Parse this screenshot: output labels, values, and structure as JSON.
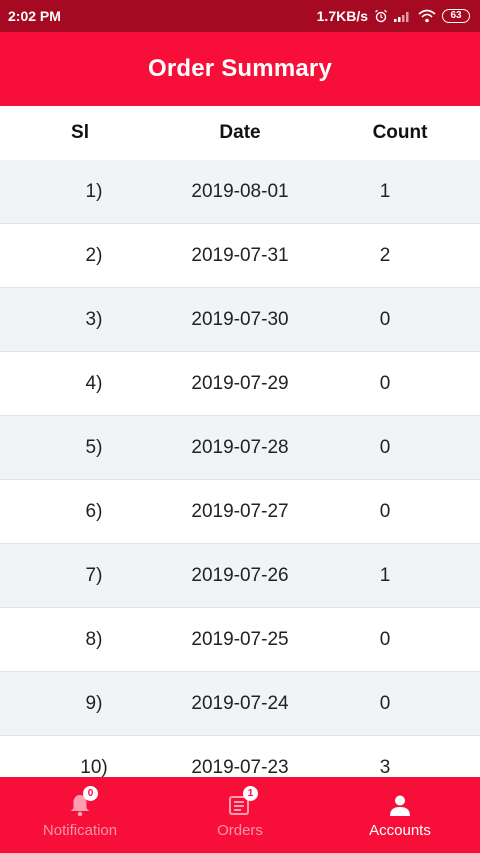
{
  "status_bar": {
    "time": "2:02 PM",
    "speed": "1.7KB/s",
    "battery": "63"
  },
  "header": {
    "title": "Order Summary"
  },
  "table": {
    "columns": [
      "Sl",
      "Date",
      "Count"
    ],
    "rows": [
      {
        "sl": "1)",
        "date": "2019-08-01",
        "count": "1"
      },
      {
        "sl": "2)",
        "date": "2019-07-31",
        "count": "2"
      },
      {
        "sl": "3)",
        "date": "2019-07-30",
        "count": "0"
      },
      {
        "sl": "4)",
        "date": "2019-07-29",
        "count": "0"
      },
      {
        "sl": "5)",
        "date": "2019-07-28",
        "count": "0"
      },
      {
        "sl": "6)",
        "date": "2019-07-27",
        "count": "0"
      },
      {
        "sl": "7)",
        "date": "2019-07-26",
        "count": "1"
      },
      {
        "sl": "8)",
        "date": "2019-07-25",
        "count": "0"
      },
      {
        "sl": "9)",
        "date": "2019-07-24",
        "count": "0"
      },
      {
        "sl": "10)",
        "date": "2019-07-23",
        "count": "3"
      }
    ]
  },
  "bottom_nav": {
    "items": [
      {
        "label": "Notification",
        "icon": "bell-icon",
        "badge": "0",
        "active": false
      },
      {
        "label": "Orders",
        "icon": "orders-icon",
        "badge": "1",
        "active": false
      },
      {
        "label": "Accounts",
        "icon": "person-icon",
        "active": true
      }
    ]
  },
  "colors": {
    "status_bar": "#a50a22",
    "primary": "#f70f3a",
    "row_alt": "#f1f4f7"
  }
}
